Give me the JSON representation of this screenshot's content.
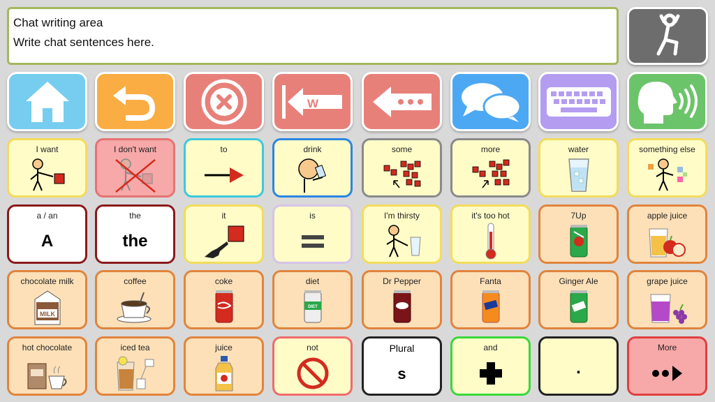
{
  "chat": {
    "title": "Chat writing area",
    "placeholder_text": "Write chat sentences here."
  },
  "toolbar": [
    {
      "name": "home",
      "icon": "house-icon",
      "color": "#76cdf0"
    },
    {
      "name": "undo",
      "icon": "undo-arrow-icon",
      "color": "#f9ad43"
    },
    {
      "name": "clear",
      "icon": "close-circle-icon",
      "color": "#e8807a"
    },
    {
      "name": "delete-word",
      "icon": "delete-word-icon",
      "color": "#e8807a"
    },
    {
      "name": "backspace",
      "icon": "backspace-icon",
      "color": "#e8807a"
    },
    {
      "name": "chat",
      "icon": "speech-bubbles-icon",
      "color": "#4da8f3"
    },
    {
      "name": "keyboard",
      "icon": "keyboard-icon",
      "color": "#b49df0"
    },
    {
      "name": "speak",
      "icon": "speaking-head-icon",
      "color": "#6cc46a"
    }
  ],
  "grid": [
    [
      {
        "label": "I want",
        "icon": "person-want-icon",
        "bg": "#fffcc8",
        "border": "#f3dc5b"
      },
      {
        "label": "I don't want",
        "icon": "person-dont-want-icon",
        "bg": "#f7a8a8",
        "border": "#e57373"
      },
      {
        "label": "to",
        "icon": "arrow-right-icon",
        "bg": "#fffcc8",
        "border": "#3dc8dc"
      },
      {
        "label": "drink",
        "icon": "person-drinking-icon",
        "bg": "#fffcc8",
        "border": "#2a86e0"
      },
      {
        "label": "some",
        "icon": "some-blocks-icon",
        "bg": "#fffcc8",
        "border": "#8a8a8a"
      },
      {
        "label": "more",
        "icon": "more-blocks-icon",
        "bg": "#fffcc8",
        "border": "#8a8a8a"
      },
      {
        "label": "water",
        "icon": "water-glass-icon",
        "bg": "#fffcc8",
        "border": "#f3dc5b"
      },
      {
        "label": "something else",
        "icon": "person-choosing-icon",
        "bg": "#fffcc8",
        "border": "#f3dc5b"
      }
    ],
    [
      {
        "label": "a / an",
        "text": "A",
        "bg": "#ffffff",
        "border": "#8b1a1a"
      },
      {
        "label": "the",
        "text": "the",
        "bg": "#ffffff",
        "border": "#8b1a1a"
      },
      {
        "label": "it",
        "icon": "pointing-hand-icon",
        "bg": "#fffcc8",
        "border": "#f3dc5b"
      },
      {
        "label": "is",
        "icon": "equals-icon",
        "bg": "#fffcc8",
        "border": "#d6c3e8"
      },
      {
        "label": "I'm thirsty",
        "icon": "person-thirsty-icon",
        "bg": "#fffcc8",
        "border": "#f3dc5b"
      },
      {
        "label": "it's too hot",
        "icon": "thermometer-icon",
        "bg": "#fffcc8",
        "border": "#f3dc5b"
      },
      {
        "label": "7Up",
        "icon": "7up-can-icon",
        "bg": "#fde0b8",
        "border": "#e0843c"
      },
      {
        "label": "apple juice",
        "icon": "apple-juice-icon",
        "bg": "#fde0b8",
        "border": "#e0843c"
      }
    ],
    [
      {
        "label": "chocolate milk",
        "icon": "chocolate-milk-carton-icon",
        "bg": "#fde0b8",
        "border": "#e0843c"
      },
      {
        "label": "coffee",
        "icon": "coffee-cup-icon",
        "bg": "#fde0b8",
        "border": "#e0843c"
      },
      {
        "label": "coke",
        "icon": "coke-can-icon",
        "bg": "#fde0b8",
        "border": "#e0843c"
      },
      {
        "label": "diet",
        "icon": "diet-soda-can-icon",
        "bg": "#fde0b8",
        "border": "#e0843c"
      },
      {
        "label": "Dr Pepper",
        "icon": "dr-pepper-can-icon",
        "bg": "#fde0b8",
        "border": "#e0843c"
      },
      {
        "label": "Fanta",
        "icon": "fanta-can-icon",
        "bg": "#fde0b8",
        "border": "#e0843c"
      },
      {
        "label": "Ginger Ale",
        "icon": "ginger-ale-can-icon",
        "bg": "#fde0b8",
        "border": "#e0843c"
      },
      {
        "label": "grape juice",
        "icon": "grape-juice-icon",
        "bg": "#fde0b8",
        "border": "#e0843c"
      }
    ],
    [
      {
        "label": "hot chocolate",
        "icon": "hot-chocolate-icon",
        "bg": "#fde0b8",
        "border": "#e0843c"
      },
      {
        "label": "iced tea",
        "icon": "iced-tea-icon",
        "bg": "#fde0b8",
        "border": "#e0843c"
      },
      {
        "label": "juice",
        "icon": "juice-bottle-icon",
        "bg": "#fde0b8",
        "border": "#e0843c"
      },
      {
        "label": "not",
        "icon": "prohibited-icon",
        "bg": "#fffcc8",
        "border": "#ef6b6b"
      },
      {
        "label": "Plural",
        "text": "s",
        "bg": "#ffffff",
        "border": "#222222"
      },
      {
        "label": "and",
        "icon": "plus-icon",
        "bg": "#fffcc8",
        "border": "#39d839"
      },
      {
        "label": "",
        "text": ".",
        "bg": "#fffcc8",
        "border": "#222222"
      },
      {
        "label": "More",
        "icon": "more-arrow-icon",
        "bg": "#f7a8a8",
        "border": "#e04040"
      }
    ]
  ]
}
